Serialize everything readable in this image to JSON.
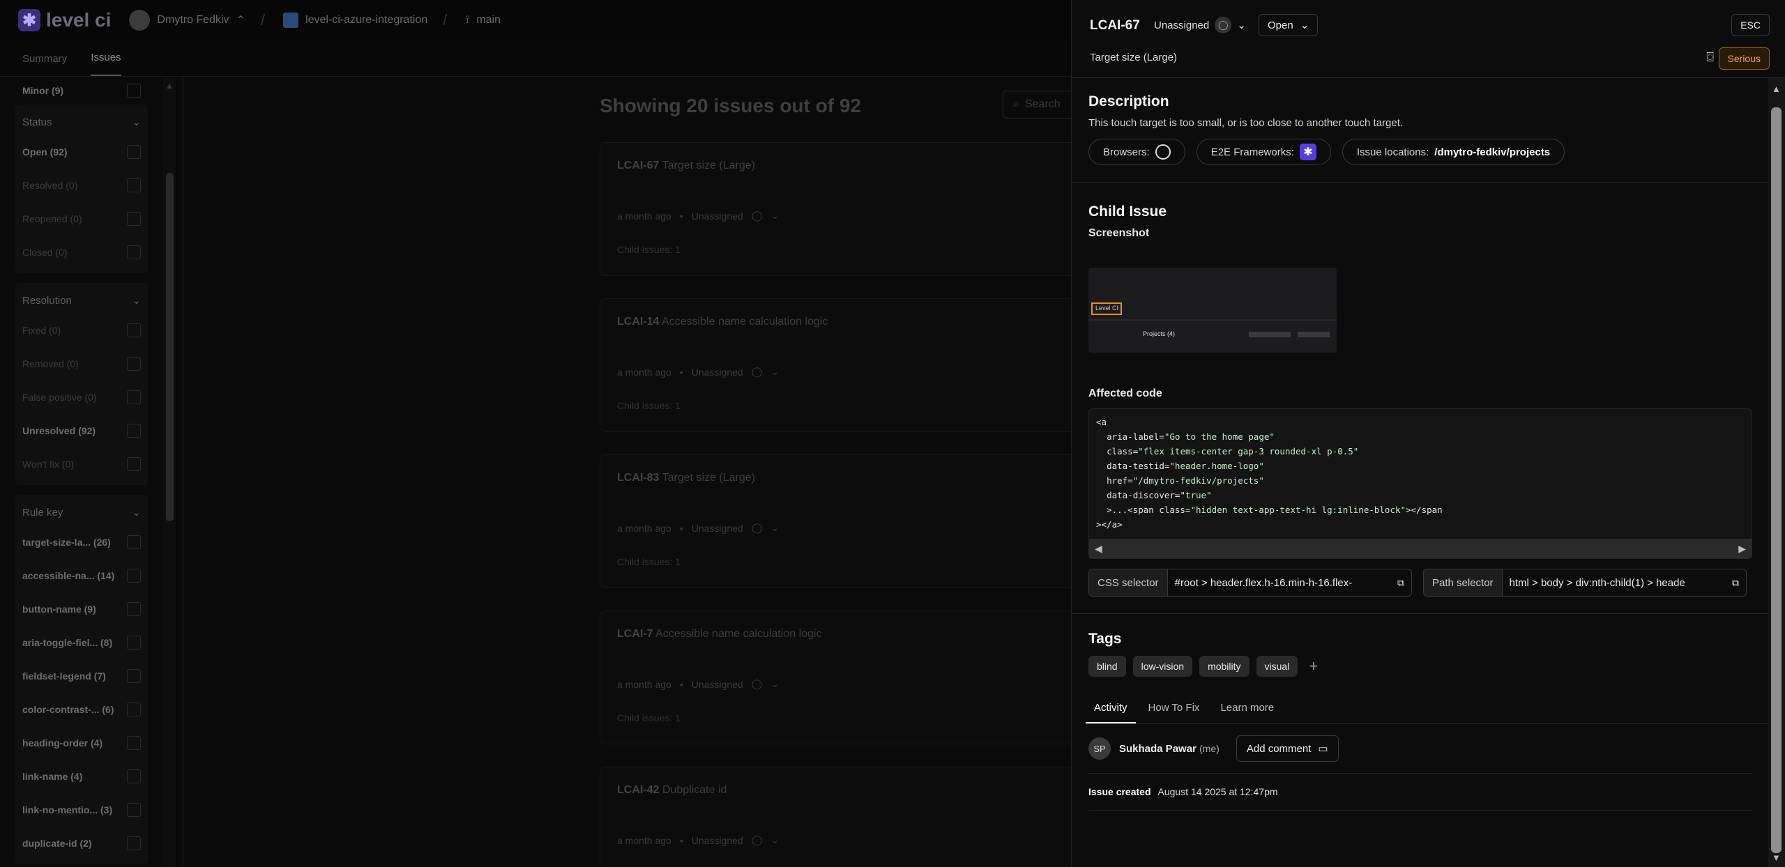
{
  "topbar": {
    "logo_text": "level ci",
    "user": "Dmytro Fedkiv",
    "project": "level-ci-azure-integration",
    "branch": "main"
  },
  "tabs": [
    "Summary",
    "Issues"
  ],
  "sidebar": {
    "top_item": {
      "label": "Minor (9)"
    },
    "status": {
      "title": "Status",
      "items": [
        {
          "label": "Open (92)",
          "on": true
        },
        {
          "label": "Resolved (0)",
          "on": false
        },
        {
          "label": "Reopened (0)",
          "on": false
        },
        {
          "label": "Closed (0)",
          "on": false
        }
      ]
    },
    "resolution": {
      "title": "Resolution",
      "items": [
        {
          "label": "Fixed (0)",
          "on": false
        },
        {
          "label": "Removed (0)",
          "on": false
        },
        {
          "label": "False positive (0)",
          "on": false
        },
        {
          "label": "Unresolved (92)",
          "on": true
        },
        {
          "label": "Won't fix (0)",
          "on": false
        }
      ]
    },
    "rulekey": {
      "title": "Rule key",
      "items": [
        {
          "label": "target-size-la...",
          "count": "(26)"
        },
        {
          "label": "accessible-na...",
          "count": "(14)"
        },
        {
          "label": "button-name",
          "count": "(9)"
        },
        {
          "label": "aria-toggle-fiel...",
          "count": "(8)"
        },
        {
          "label": "fieldset-legend",
          "count": "(7)"
        },
        {
          "label": "color-contrast-...",
          "count": "(6)"
        },
        {
          "label": "heading-order",
          "count": "(4)"
        },
        {
          "label": "link-name",
          "count": "(4)"
        },
        {
          "label": "link-no-mentio...",
          "count": "(3)"
        },
        {
          "label": "duplicate-id",
          "count": "(2)"
        }
      ]
    }
  },
  "main": {
    "title": "Showing 20 issues out of 92",
    "search_placeholder": "Search",
    "cards": [
      {
        "id": "LCAI-67",
        "title": "Target size (Large)",
        "time": "a month ago",
        "assignee": "Unassigned",
        "child": "Child issues: 1"
      },
      {
        "id": "LCAI-14",
        "title": "Accessible name calculation logic",
        "time": "a month ago",
        "assignee": "Unassigned",
        "child": "Child issues: 1"
      },
      {
        "id": "LCAI-83",
        "title": "Target size (Large)",
        "time": "a month ago",
        "assignee": "Unassigned",
        "child": "Child issues: 1"
      },
      {
        "id": "LCAI-7",
        "title": "Accessible name calculation logic",
        "time": "a month ago",
        "assignee": "Unassigned",
        "child": "Child issues: 1"
      },
      {
        "id": "LCAI-42",
        "title": "Dubplicate id",
        "time": "a month ago",
        "assignee": "Unassigned",
        "child": ""
      }
    ]
  },
  "panel": {
    "id": "LCAI-67",
    "assignee": "Unassigned",
    "status": "Open",
    "esc": "ESC",
    "subtitle": "Target size (Large)",
    "severity": "Serious",
    "description_title": "Description",
    "description": "This touch target is too small, or is too close to another touch target.",
    "browsers_label": "Browsers:",
    "e2e_label": "E2E Frameworks:",
    "locations_label": "Issue locations:",
    "locations_value": "/dmytro-fedkiv/projects",
    "child_title": "Child Issue",
    "screenshot_label": "Screenshot",
    "screenshot_thumb": {
      "logo": "Level CI",
      "heading": "Projects (4)"
    },
    "affected_label": "Affected code",
    "code": {
      "open": "<a",
      "attrs": [
        {
          "name": "aria-label",
          "value": "\"Go to the home page\""
        },
        {
          "name": "class",
          "value": "\"flex items-center gap-3 rounded-xl p-0.5\""
        },
        {
          "name": "data-testid",
          "value": "\"header.home-logo\""
        },
        {
          "name": "href",
          "value": "\"/dmytro-fedkiv/projects\""
        },
        {
          "name": "data-discover",
          "value": "\"true\""
        }
      ],
      "child_prefix": "  >...<span class=",
      "child_class": "\"hidden text-app-text-hi lg:inline-block\"",
      "child_suffix": "></span",
      "close": "></a>"
    },
    "css_selector_label": "CSS selector",
    "css_selector_value": "#root > header.flex.h-16.min-h-16.flex-",
    "path_selector_label": "Path selector",
    "path_selector_value": "html > body > div:nth-child(1) > heade",
    "tags_title": "Tags",
    "tags": [
      "blind",
      "low-vision",
      "mobility",
      "visual"
    ],
    "tabs": [
      "Activity",
      "How To Fix",
      "Learn more"
    ],
    "commenter_initials": "SP",
    "commenter": "Sukhada Pawar",
    "commenter_me": "(me)",
    "add_comment": "Add comment",
    "created_label": "Issue created",
    "created_value": "August 14 2025 at 12:47pm"
  }
}
